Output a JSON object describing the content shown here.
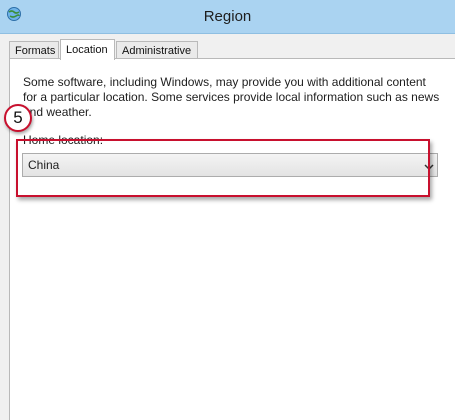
{
  "window": {
    "title": "Region",
    "icon": "globe-icon"
  },
  "tabs": [
    {
      "label": "Formats",
      "active": false
    },
    {
      "label": "Location",
      "active": true
    },
    {
      "label": "Administrative",
      "active": false
    }
  ],
  "location": {
    "description": "Some software, including Windows, may provide you with additional content for a particular location. Some services provide local information such as news and weather.",
    "home_location_label": "Home location:",
    "home_location_value": "China"
  },
  "annotation": {
    "step_number": "5",
    "color": "#c8102e"
  }
}
